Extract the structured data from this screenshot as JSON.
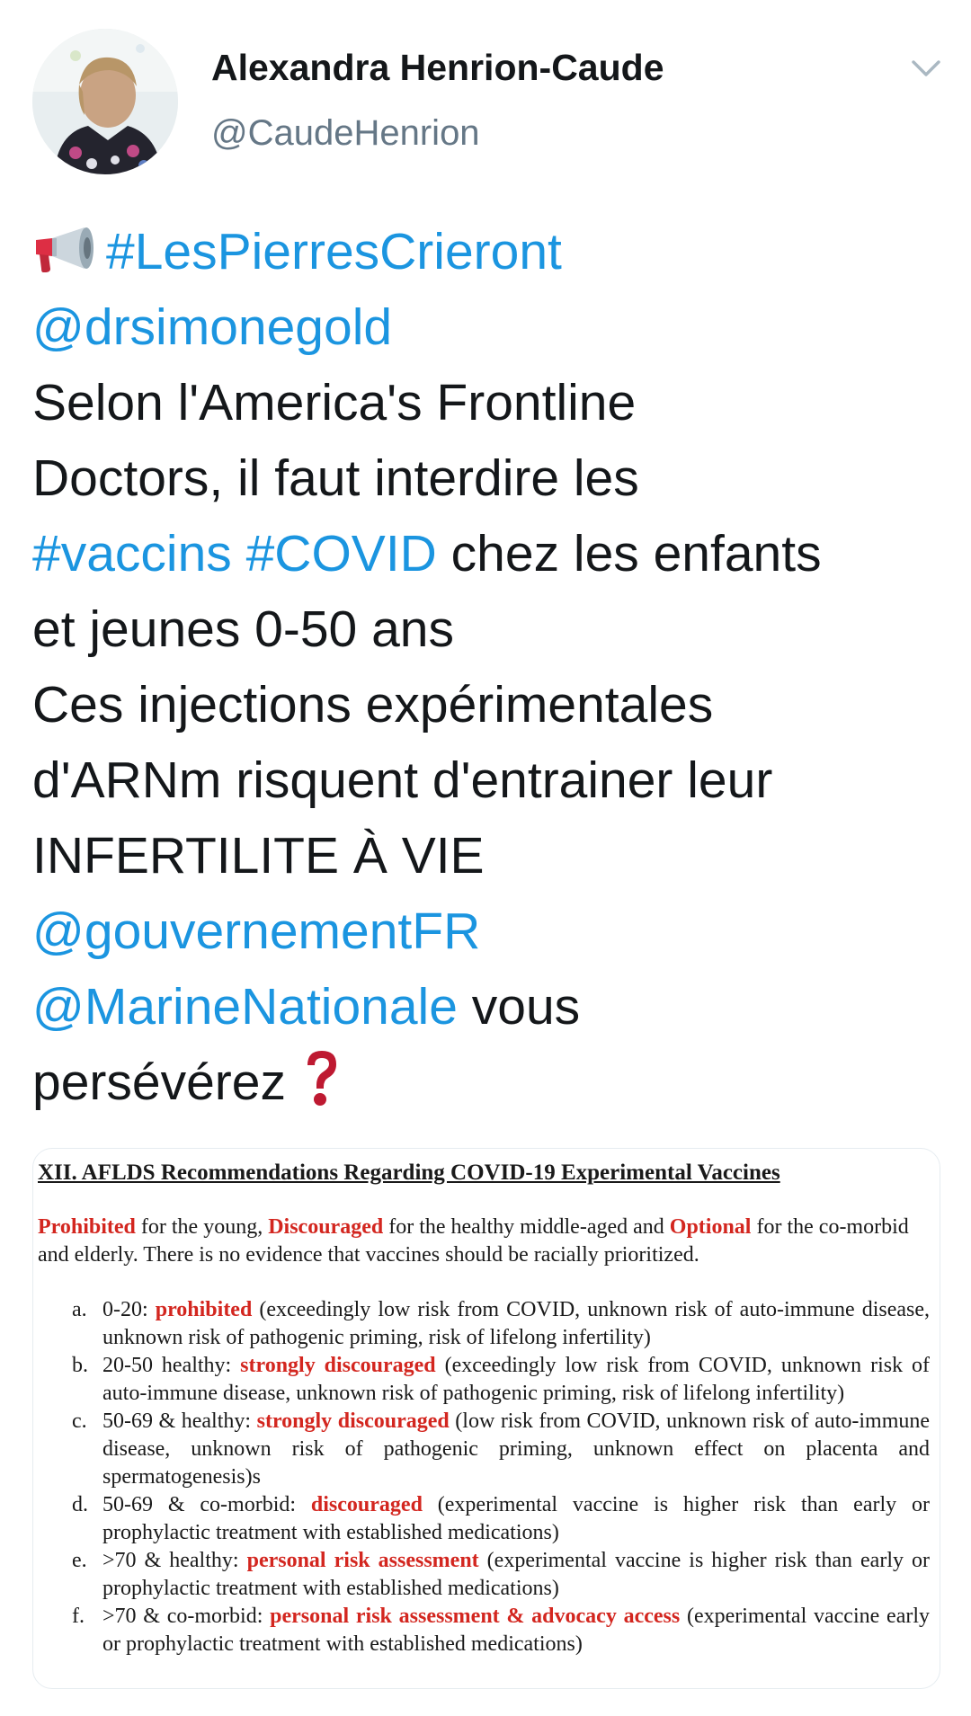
{
  "tweet": {
    "author_name": "Alexandra Henrion-Caude",
    "author_handle": "@CaudeHenrion",
    "lines": [
      [
        {
          "t": "#LesPierresCrieront",
          "link": true
        }
      ],
      [
        {
          "t": "@drsimonegold",
          "link": true
        }
      ],
      [
        {
          "t": "Selon l'America's Frontline",
          "link": false
        }
      ],
      [
        {
          "t": "Doctors, il faut interdire les",
          "link": false
        }
      ],
      [
        {
          "t": "#vaccins #COVID",
          "link": true
        },
        {
          "t": " chez les enfants",
          "link": false
        }
      ],
      [
        {
          "t": "et jeunes 0-50 ans",
          "link": false
        }
      ],
      [
        {
          "t": "Ces injections expérimentales",
          "link": false
        }
      ],
      [
        {
          "t": "d'ARNm risquent d'entrainer leur",
          "link": false
        }
      ],
      [
        {
          "t": "INFERTILITE À VIE",
          "link": false
        }
      ],
      [
        {
          "t": "@gouvernementFR",
          "link": true
        }
      ],
      [
        {
          "t": "@MarineNationale",
          "link": true
        },
        {
          "t": " vous",
          "link": false
        }
      ],
      [
        {
          "t": "persévérez",
          "link": false
        }
      ]
    ],
    "icons": {
      "leading": "megaphone-icon",
      "trailing": "red-question-mark-icon",
      "menu": "chevron-down-icon"
    }
  },
  "document": {
    "title": "XII. AFLDS Recommendations Regarding COVID-19 Experimental Vaccines",
    "intro": [
      {
        "t": "Prohibited",
        "red": true
      },
      {
        "t": " for the young, ",
        "red": false
      },
      {
        "t": "Discouraged",
        "red": true
      },
      {
        "t": " for the healthy middle-aged and ",
        "red": false
      },
      {
        "t": "Optional",
        "red": true
      },
      {
        "t": " for the co-morbid and elderly. There is no evidence that vaccines should be racially prioritized.",
        "red": false
      }
    ],
    "items": [
      {
        "marker": "a.",
        "parts": [
          {
            "t": "0-20: ",
            "red": false
          },
          {
            "t": "prohibited",
            "red": true
          },
          {
            "t": " (exceedingly low risk from COVID, unknown risk of auto-immune disease, unknown risk of pathogenic priming, risk of lifelong infertility)",
            "red": false
          }
        ]
      },
      {
        "marker": "b.",
        "parts": [
          {
            "t": "20-50 healthy: ",
            "red": false
          },
          {
            "t": "strongly discouraged",
            "red": true
          },
          {
            "t": " (exceedingly low risk from COVID, unknown risk of auto-immune disease, unknown risk of pathogenic priming, risk of lifelong infertility)",
            "red": false
          }
        ]
      },
      {
        "marker": "c.",
        "parts": [
          {
            "t": "50-69 & healthy: ",
            "red": false
          },
          {
            "t": "strongly discouraged",
            "red": true
          },
          {
            "t": " (low risk from COVID, unknown risk of auto-immune disease, unknown risk of pathogenic priming, unknown effect on placenta and spermatogenesis)s",
            "red": false
          }
        ]
      },
      {
        "marker": "d.",
        "parts": [
          {
            "t": "50-69 & co-morbid: ",
            "red": false
          },
          {
            "t": "discouraged",
            "red": true
          },
          {
            "t": " (experimental vaccine is higher risk than early or prophylactic treatment with established medications)",
            "red": false
          }
        ]
      },
      {
        "marker": "e.",
        "parts": [
          {
            "t": ">70 & healthy: ",
            "red": false
          },
          {
            "t": "personal risk assessment",
            "red": true
          },
          {
            "t": " (experimental vaccine is higher risk than early or prophylactic treatment with established medications)",
            "red": false
          }
        ]
      },
      {
        "marker": "f.",
        "parts": [
          {
            "t": ">70 & co-morbid: ",
            "red": false
          },
          {
            "t": "personal risk assessment & advocacy access",
            "red": true
          },
          {
            "t": " (experimental vaccine early or prophylactic treatment with established medications)",
            "red": false
          }
        ]
      }
    ]
  },
  "colors": {
    "link": "#1b95e0",
    "text": "#14171a",
    "muted": "#657786",
    "doc_red": "#d3261f"
  }
}
